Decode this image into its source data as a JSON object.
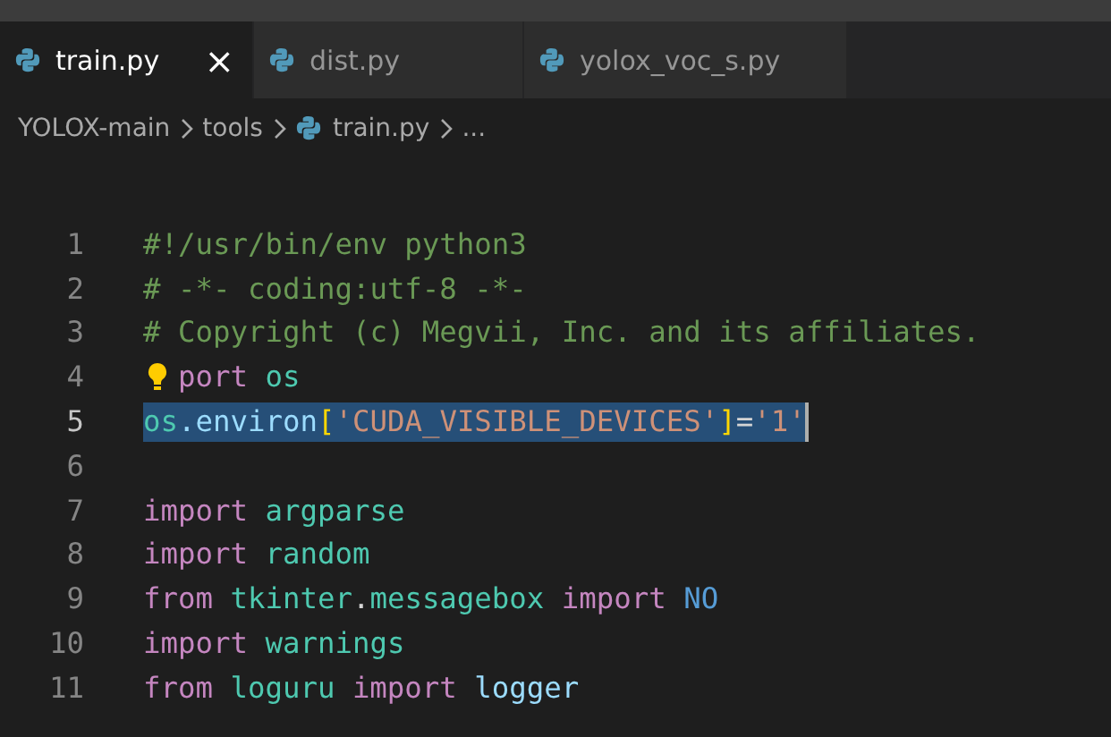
{
  "tabs": [
    {
      "label": "train.py",
      "selected": true,
      "close": "×"
    },
    {
      "label": "dist.py",
      "selected": false
    },
    {
      "label": "yolox_voc_s.py",
      "selected": false
    }
  ],
  "breadcrumb": [
    {
      "label": "YOLOX-main",
      "kind": "folder"
    },
    {
      "label": "tools",
      "kind": "folder"
    },
    {
      "label": "train.py",
      "kind": "file"
    },
    {
      "label": "...",
      "kind": "more"
    }
  ],
  "editor": {
    "lines": [
      {
        "number": "1",
        "selected": false,
        "tokens": [
          {
            "text": "#!/usr/bin/env python3",
            "kind": "comment"
          }
        ]
      },
      {
        "number": "2",
        "selected": false,
        "tokens": [
          {
            "text": "# -*- coding:utf-8 -*-",
            "kind": "comment"
          }
        ]
      },
      {
        "number": "3",
        "selected": false,
        "tokens": [
          {
            "text": "# Copyright (c) Megvii, Inc. and its affiliates.",
            "kind": "comment"
          }
        ]
      },
      {
        "number": "4",
        "selected": false,
        "lightbulb": true,
        "tokens": [
          {
            "text": "port",
            "kind": "keyword"
          },
          {
            "text": "os",
            "kind": "module",
            "space": true
          }
        ]
      },
      {
        "number": "5",
        "selected": true,
        "tokens": [
          {
            "text": "os",
            "kind": "module"
          },
          {
            "text": ".environ",
            "kind": "variable"
          },
          {
            "text": "[",
            "kind": "bracket"
          },
          {
            "text": "'CUDA_VISIBLE_DEVICES'",
            "kind": "string"
          },
          {
            "text": "]",
            "kind": "bracket"
          },
          {
            "text": "=",
            "kind": "plain"
          },
          {
            "text": "'1'",
            "kind": "string"
          }
        ]
      },
      {
        "number": "6",
        "selected": false
      },
      {
        "number": "7",
        "selected": false,
        "tokens": [
          {
            "text": "import",
            "kind": "keyword"
          },
          {
            "text": "argparse",
            "kind": "module",
            "space": true
          }
        ]
      },
      {
        "number": "8",
        "selected": false,
        "tokens": [
          {
            "text": "import",
            "kind": "keyword"
          },
          {
            "text": "random",
            "kind": "module",
            "space": true
          }
        ]
      },
      {
        "number": "9",
        "selected": false,
        "tokens": [
          {
            "text": "from",
            "kind": "keyword"
          },
          {
            "text": "tkinter",
            "kind": "module",
            "space": true
          },
          {
            "text": ".",
            "kind": "plain"
          },
          {
            "text": "messagebox",
            "kind": "module"
          },
          {
            "text": "import",
            "kind": "keyword",
            "space": true
          },
          {
            "text": "NO",
            "kind": "constant",
            "space": true
          }
        ]
      },
      {
        "number": "10",
        "selected": false,
        "tokens": [
          {
            "text": "import",
            "kind": "keyword"
          },
          {
            "text": "warnings",
            "kind": "module",
            "space": true
          }
        ]
      },
      {
        "number": "11",
        "selected": false,
        "tokens": [
          {
            "text": "from",
            "kind": "keyword"
          },
          {
            "text": "loguru",
            "kind": "module",
            "space": true
          },
          {
            "text": "import",
            "kind": "keyword",
            "space": true
          },
          {
            "text": "logger",
            "kind": "variable",
            "space": true
          }
        ]
      }
    ]
  }
}
